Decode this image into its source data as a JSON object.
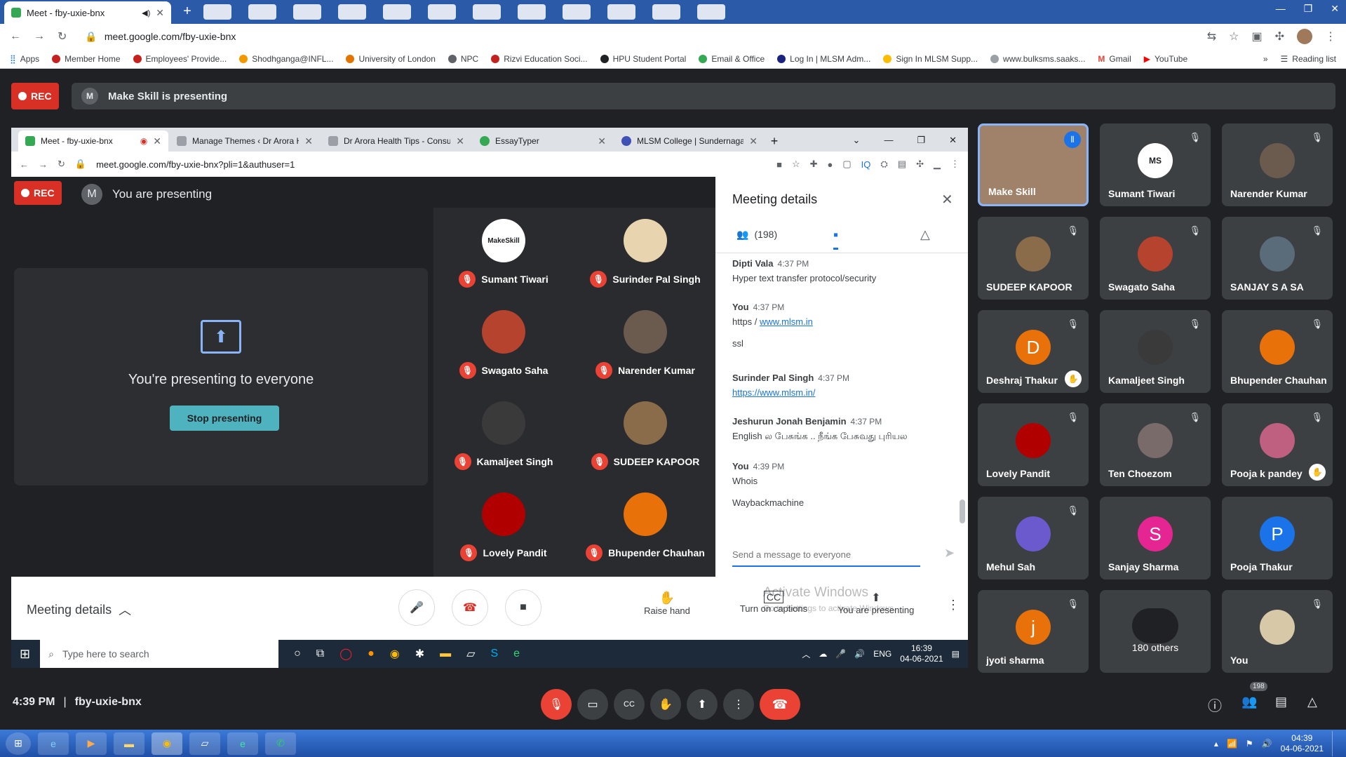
{
  "outer_browser": {
    "tab_title": "Meet - fby-uxie-bnx",
    "url": "meet.google.com/fby-uxie-bnx",
    "bookmarks": [
      "Apps",
      "Member Home",
      "Employees' Provide...",
      "Shodhganga@INFL...",
      "University of London",
      "NPC",
      "Rizvi Education Soci...",
      "HPU Student Portal",
      "Email & Office",
      "Log In | MLSM Adm...",
      "Sign In MLSM Supp...",
      "www.bulksms.saaks...",
      "Gmail",
      "YouTube"
    ],
    "reading_list": "Reading list"
  },
  "meet_top": {
    "rec_label": "REC",
    "presenter_initial": "M",
    "presenting_text": "Make Skill is presenting"
  },
  "inner_browser": {
    "tabs": [
      "Meet - fby-uxie-bnx",
      "Manage Themes ‹ Dr Arora H",
      "Dr Arora Health Tips - Consu",
      "EssayTyper",
      "MLSM College | Sundernaga"
    ],
    "url": "meet.google.com/fby-uxie-bnx?pli=1&authuser=1"
  },
  "inner_meet": {
    "rec_label": "REC",
    "presenter_initial": "M",
    "presenting_text": "You are presenting",
    "present_message": "You're presenting to everyone",
    "stop_button": "Stop presenting",
    "tiles": [
      {
        "name": "Sumant Tiwari",
        "avatar": "MakeSkill"
      },
      {
        "name": "Surinder Pal Singh",
        "avatar": ""
      },
      {
        "name": "Swagato Saha",
        "avatar": ""
      },
      {
        "name": "Narender Kumar",
        "avatar": ""
      },
      {
        "name": "Kamaljeet Singh",
        "avatar": ""
      },
      {
        "name": "SUDEEP KAPOOR",
        "avatar": ""
      },
      {
        "name": "Lovely Pandit",
        "avatar": ""
      },
      {
        "name": "Bhupender Chauhan",
        "avatar": ""
      }
    ]
  },
  "details": {
    "title": "Meeting details",
    "people_count": "(198)",
    "messages": [
      {
        "who": "Dipti Vala",
        "time": "4:37 PM",
        "lines": [
          "Hyper text transfer protocol/security"
        ]
      },
      {
        "who": "You",
        "time": "4:37 PM",
        "lines": [
          "https / ",
          "www.mlsm.in"
        ]
      },
      {
        "who": "",
        "time": "",
        "lines": [
          "ssl"
        ]
      },
      {
        "who": "Surinder Pal Singh",
        "time": "4:37 PM",
        "lines": [
          "https://www.mlsm.in/"
        ]
      },
      {
        "who": "Jeshurun Jonah Benjamin",
        "time": "4:37 PM",
        "lines": [
          "English ல பேசுங்க .. நீங்க பேசுவது புரியல"
        ]
      },
      {
        "who": "You",
        "time": "4:39 PM",
        "lines": [
          "Whois"
        ]
      },
      {
        "who": "",
        "time": "",
        "lines": [
          "Waybackmachine"
        ]
      }
    ],
    "input_placeholder": "Send a message to everyone"
  },
  "inner_bottom": {
    "meeting_details": "Meeting details",
    "raise_hand": "Raise hand",
    "captions": "Turn on captions",
    "presenting": "You are presenting",
    "watermark_title": "Activate Windows",
    "watermark_sub": "Go to Settings to activate Windows."
  },
  "inner_taskbar": {
    "search_placeholder": "Type here to search",
    "lang": "ENG",
    "time": "16:39",
    "date": "04-06-2021"
  },
  "right_grid": [
    {
      "name": "Make Skill",
      "type": "video",
      "initial": "",
      "color": "#a47c5a",
      "muted": false,
      "hand": false,
      "active": true
    },
    {
      "name": "Sumant Tiwari",
      "type": "logo",
      "initial": "MS",
      "color": "#ffffff",
      "muted": true,
      "hand": false
    },
    {
      "name": "Narender Kumar",
      "type": "photo",
      "initial": "",
      "color": "#6b5a4e",
      "muted": true,
      "hand": false
    },
    {
      "name": "SUDEEP KAPOOR",
      "type": "photo",
      "initial": "",
      "color": "#8a6b4a",
      "muted": true,
      "hand": false
    },
    {
      "name": "Swagato Saha",
      "type": "photo",
      "initial": "",
      "color": "#b5432e",
      "muted": true,
      "hand": false
    },
    {
      "name": "SANJAY S A SA",
      "type": "photo",
      "initial": "",
      "color": "#5a6b7a",
      "muted": true,
      "hand": false
    },
    {
      "name": "Deshraj Thakur",
      "type": "letter",
      "initial": "D",
      "color": "#e8710a",
      "muted": true,
      "hand": true
    },
    {
      "name": "Kamaljeet Singh",
      "type": "photo",
      "initial": "",
      "color": "#3a3a3a",
      "muted": true,
      "hand": false
    },
    {
      "name": "Bhupender Chauhan",
      "type": "photo",
      "initial": "",
      "color": "#e8710a",
      "muted": true,
      "hand": false
    },
    {
      "name": "Lovely Pandit",
      "type": "photo",
      "initial": "",
      "color": "#b00000",
      "muted": true,
      "hand": false
    },
    {
      "name": "Ten Choezom",
      "type": "photo",
      "initial": "",
      "color": "#7a6b6b",
      "muted": true,
      "hand": false
    },
    {
      "name": "Pooja k pandey",
      "type": "photo",
      "initial": "",
      "color": "#c06080",
      "muted": true,
      "hand": true
    },
    {
      "name": "Mehul Sah",
      "type": "photo",
      "initial": "",
      "color": "#6a5acd",
      "muted": true,
      "hand": false
    },
    {
      "name": "Sanjay Sharma",
      "type": "letter",
      "initial": "S",
      "color": "#e52592",
      "muted": false,
      "hand": false
    },
    {
      "name": "Pooja Thakur",
      "type": "letter",
      "initial": "P",
      "color": "#1a73e8",
      "muted": false,
      "hand": false
    },
    {
      "name": "jyoti sharma",
      "type": "letter",
      "initial": "j",
      "color": "#e8710a",
      "muted": true,
      "hand": false
    },
    {
      "name": "180 others",
      "type": "others",
      "initial": "",
      "color": "#3c4043",
      "muted": false,
      "hand": false
    },
    {
      "name": "You",
      "type": "photo",
      "initial": "",
      "color": "#d7c8a8",
      "muted": true,
      "hand": false
    }
  ],
  "meet_bottom": {
    "time": "4:39 PM",
    "separator": "|",
    "code": "fby-uxie-bnx",
    "people_badge": "198"
  },
  "taskbar": {
    "time": "04:39",
    "date": "04-06-2021"
  }
}
